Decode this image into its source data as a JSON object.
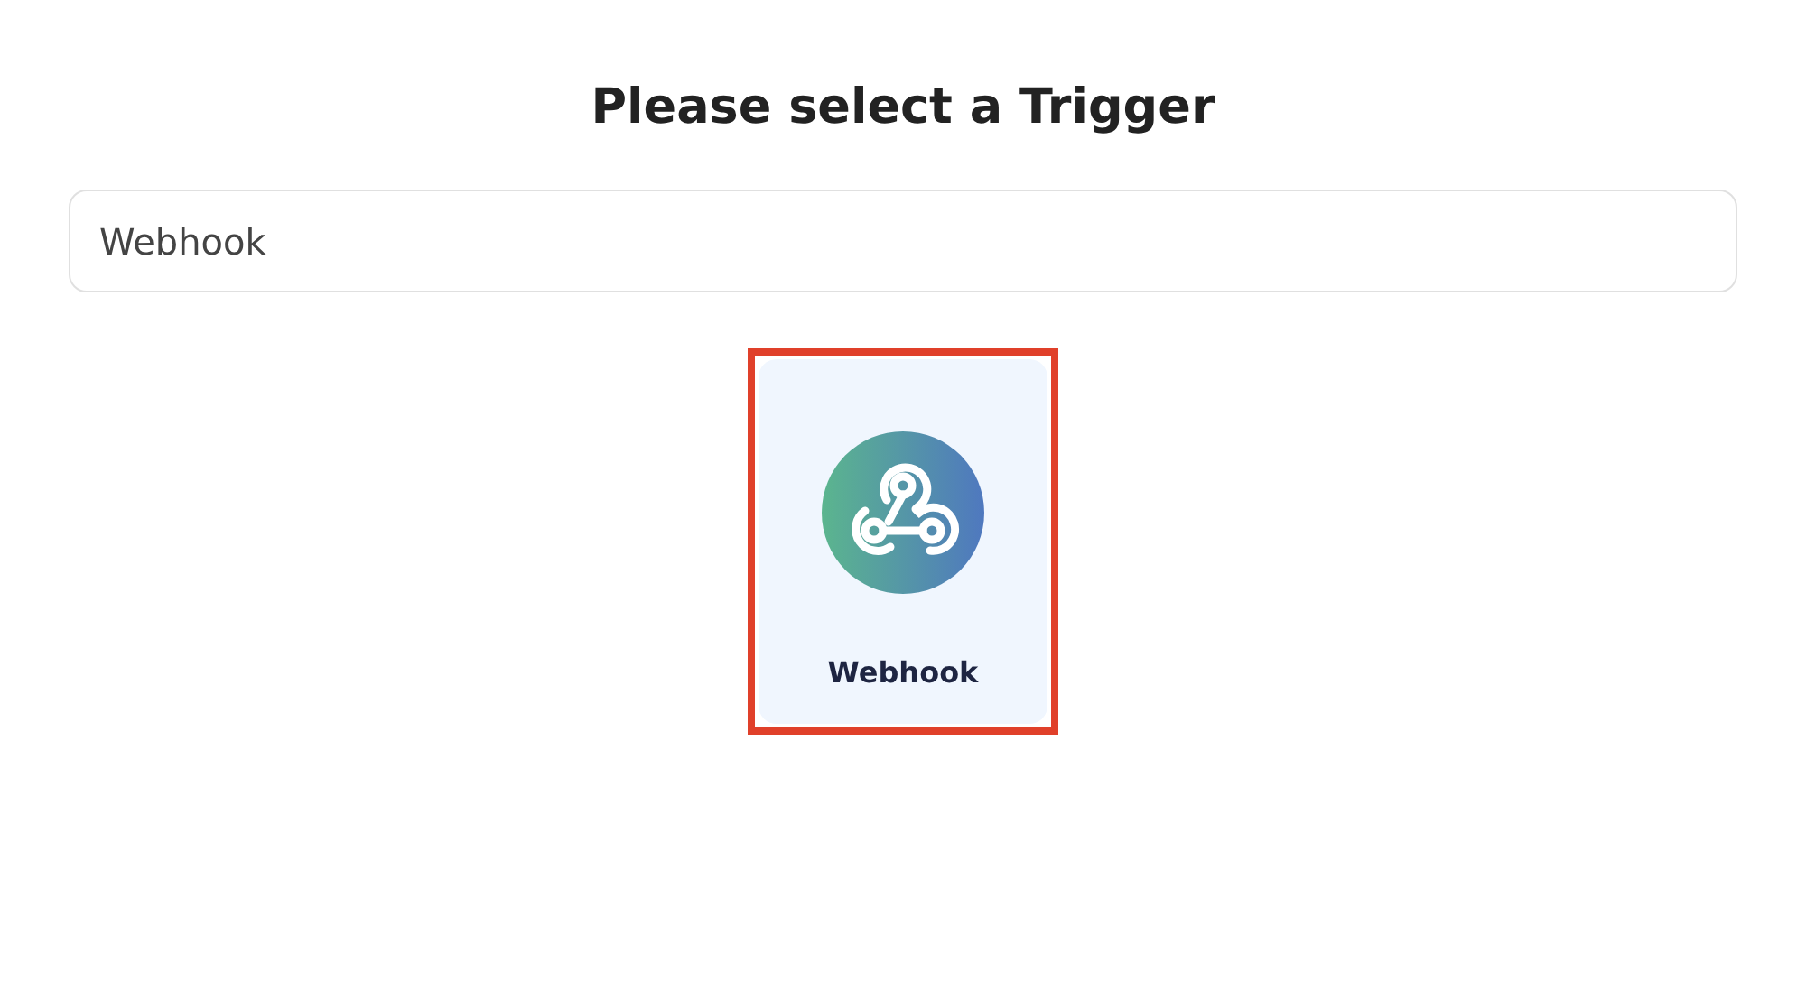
{
  "title": "Please select a Trigger",
  "search": {
    "value": "Webhook"
  },
  "triggers": [
    {
      "label": "Webhook",
      "highlighted": true
    }
  ]
}
